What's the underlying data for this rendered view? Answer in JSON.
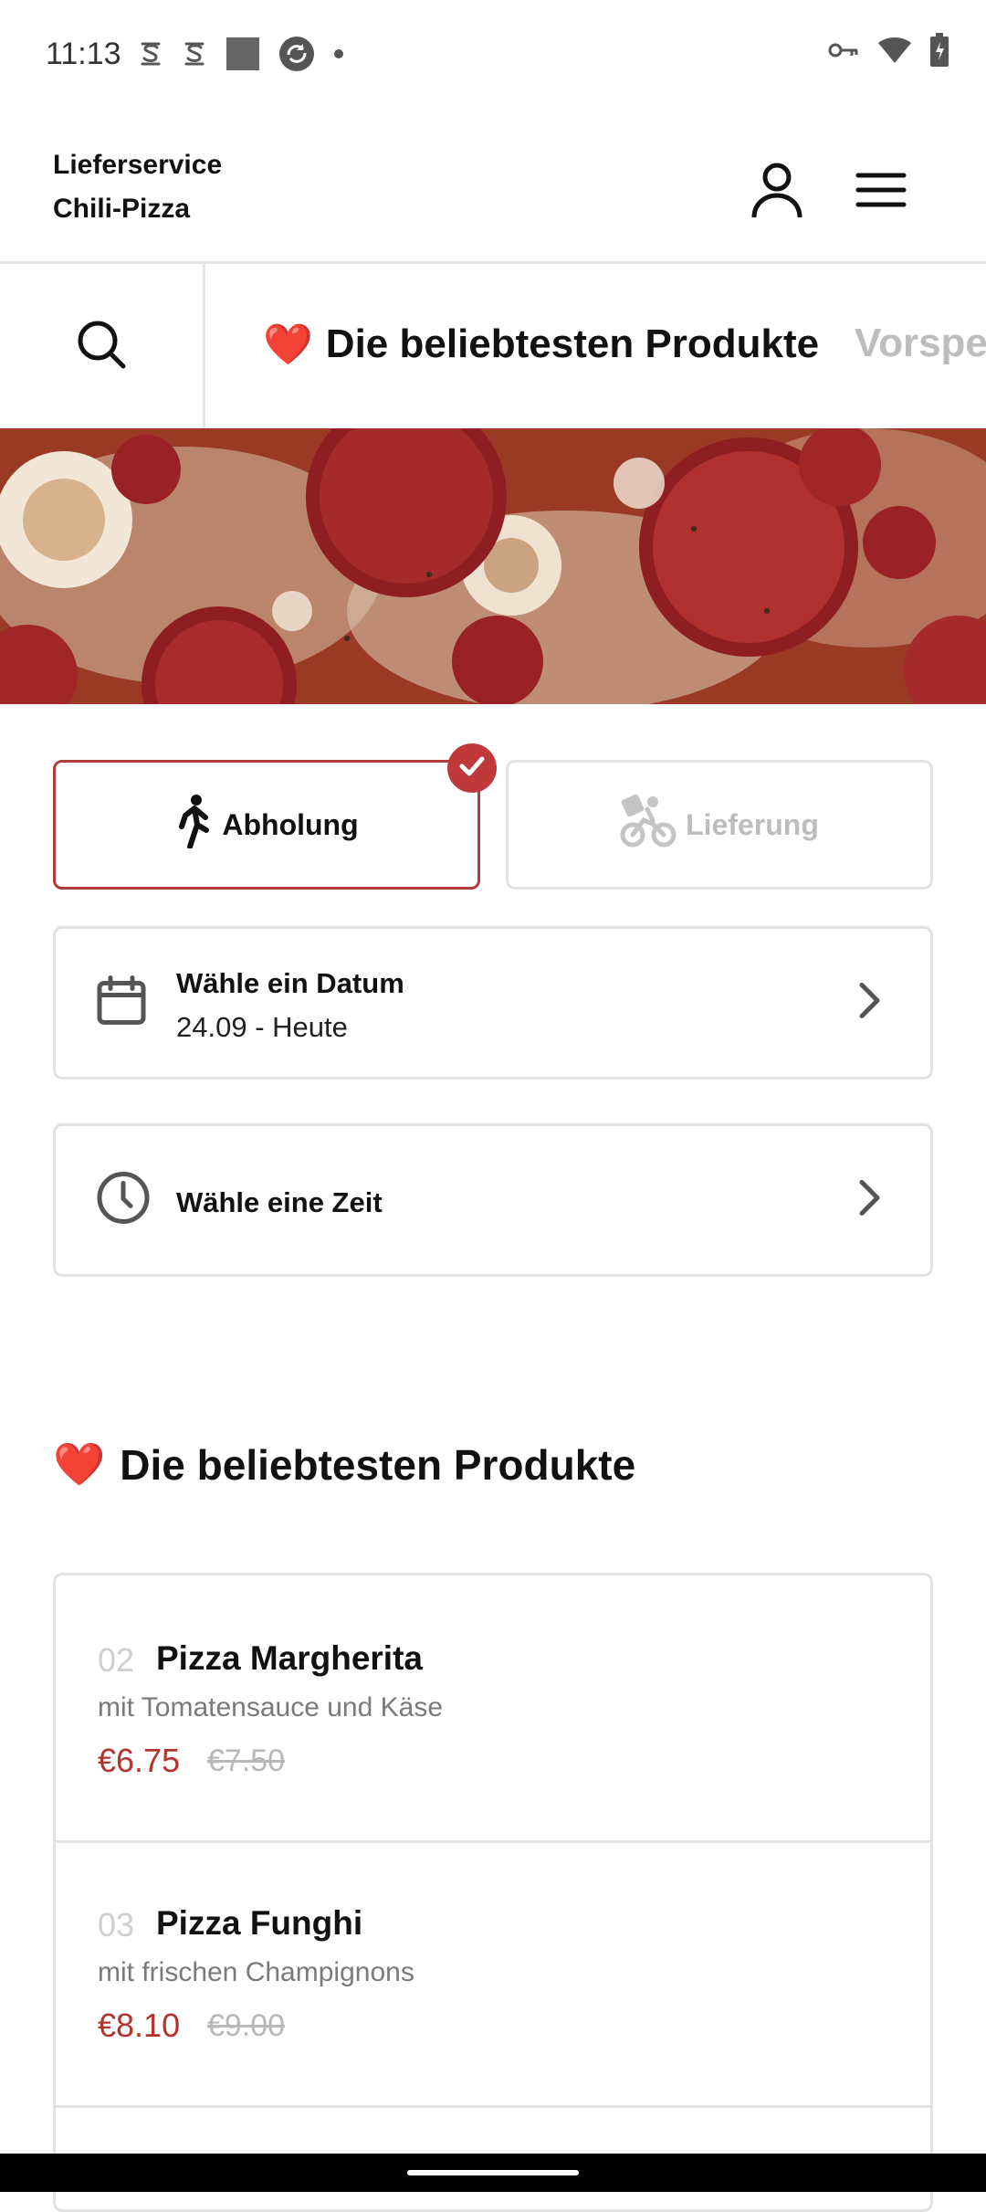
{
  "status": {
    "time": "11:13",
    "left_icons": [
      "notification-s-icon",
      "notification-s-icon",
      "square-icon",
      "sync-icon",
      "dot-icon"
    ],
    "right_icons": [
      "vpn-key-icon",
      "wifi-icon",
      "battery-charging-icon"
    ]
  },
  "header": {
    "brand_line1": "Lieferservice",
    "brand_line2": "Chili-Pizza",
    "account_icon": "account-icon",
    "menu_icon": "menu-icon"
  },
  "category_bar": {
    "search_icon": "search-icon",
    "active_emoji": "❤️",
    "active_label": "Die beliebtesten Produkte",
    "next_label": "Vorspe"
  },
  "order_mode": {
    "pickup_label": "Abholung",
    "delivery_label": "Lieferung",
    "selected": "pickup"
  },
  "date_picker": {
    "title": "Wähle ein Datum",
    "value": "24.09 - Heute"
  },
  "time_picker": {
    "title": "Wähle eine Zeit"
  },
  "section": {
    "emoji": "❤️",
    "title": "Die beliebtesten Produkte"
  },
  "products": [
    {
      "number": "02",
      "name": "Pizza Margherita",
      "description": "mit Tomatensauce und Käse",
      "price": "€6.75",
      "old_price": "€7.50"
    },
    {
      "number": "03",
      "name": "Pizza Funghi",
      "description": "mit frischen Champignons",
      "price": "€8.10",
      "old_price": "€9.00"
    }
  ],
  "colors": {
    "accent": "#c0393a",
    "price": "#b3342f",
    "border": "#e2e2e2"
  }
}
